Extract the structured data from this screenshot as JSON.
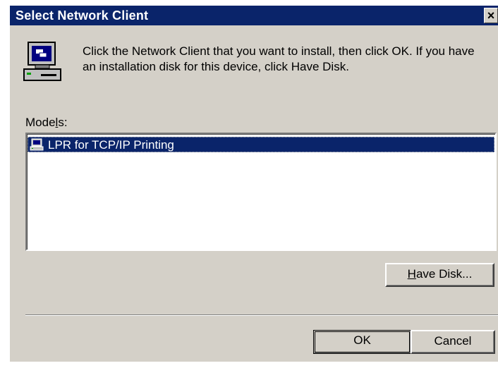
{
  "dialog": {
    "title": "Select Network Client",
    "close_label": "×",
    "icon": "network-computer-icon",
    "description": "Click the Network Client that you want to install, then click OK. If you have an installation disk for this device, click Have Disk."
  },
  "models": {
    "label_prefix": "Mode",
    "label_mnemonic": "l",
    "label_suffix": "s:",
    "items": [
      {
        "label": "LPR for TCP/IP Printing",
        "icon": "network-computer-icon",
        "selected": true
      }
    ]
  },
  "buttons": {
    "have_disk_mnemonic": "H",
    "have_disk_rest": "ave Disk...",
    "ok": "OK",
    "cancel": "Cancel"
  },
  "colors": {
    "titlebar": "#0a246a",
    "face": "#d4d0c8",
    "selection": "#0a246a"
  }
}
